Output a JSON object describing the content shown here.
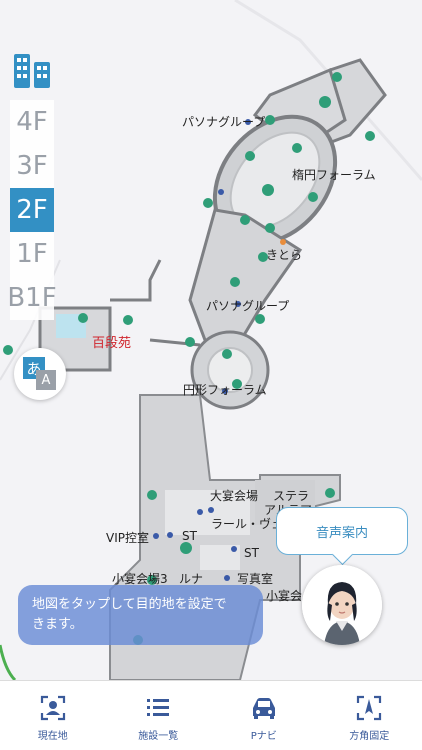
{
  "floors": [
    "4F",
    "3F",
    "2F",
    "1F",
    "B1F"
  ],
  "active_floor": "2F",
  "map": {
    "labels": {
      "pasona_group_top": "パソナグループ",
      "ellipse_forum": "楕円フォーラム",
      "kitora": "きとら",
      "pasona_group_mid": "パソナグループ",
      "hyakudanen": "百段苑",
      "circle_forum": "円形フォーラム",
      "grand_banquet": "大宴会場",
      "stella": "ステラ",
      "altair": "アルテア",
      "lara_vega": "ラール・ヴェ",
      "vip_room": "VIP控室",
      "st_1": "ST",
      "st_2": "ST",
      "small_banquet_3": "小宴会場3",
      "luna": "ルナ",
      "photo_studio": "写真室",
      "small_banquet": "小宴会"
    }
  },
  "lang_button": {
    "label": "あ",
    "secondary": "A"
  },
  "voice_guide": {
    "label": "音声案内"
  },
  "hint_toast": {
    "line1": "地図をタップして目的地を設定で",
    "line2": "きます。"
  },
  "nav": {
    "items": [
      {
        "label": "現在地",
        "icon": "current-location-icon"
      },
      {
        "label": "施設一覧",
        "icon": "list-icon"
      },
      {
        "label": "Pナビ",
        "icon": "car-icon"
      },
      {
        "label": "方角固定",
        "icon": "compass-icon"
      }
    ]
  },
  "colors": {
    "accent": "#3390c4",
    "nav_icon": "#3a5a9a",
    "map_wall": "#8a8c90",
    "map_room": "#d9dadc",
    "map_teal": "#2f9e78",
    "toast_bg": "#6a8cd6",
    "label_red": "#d0262e"
  }
}
